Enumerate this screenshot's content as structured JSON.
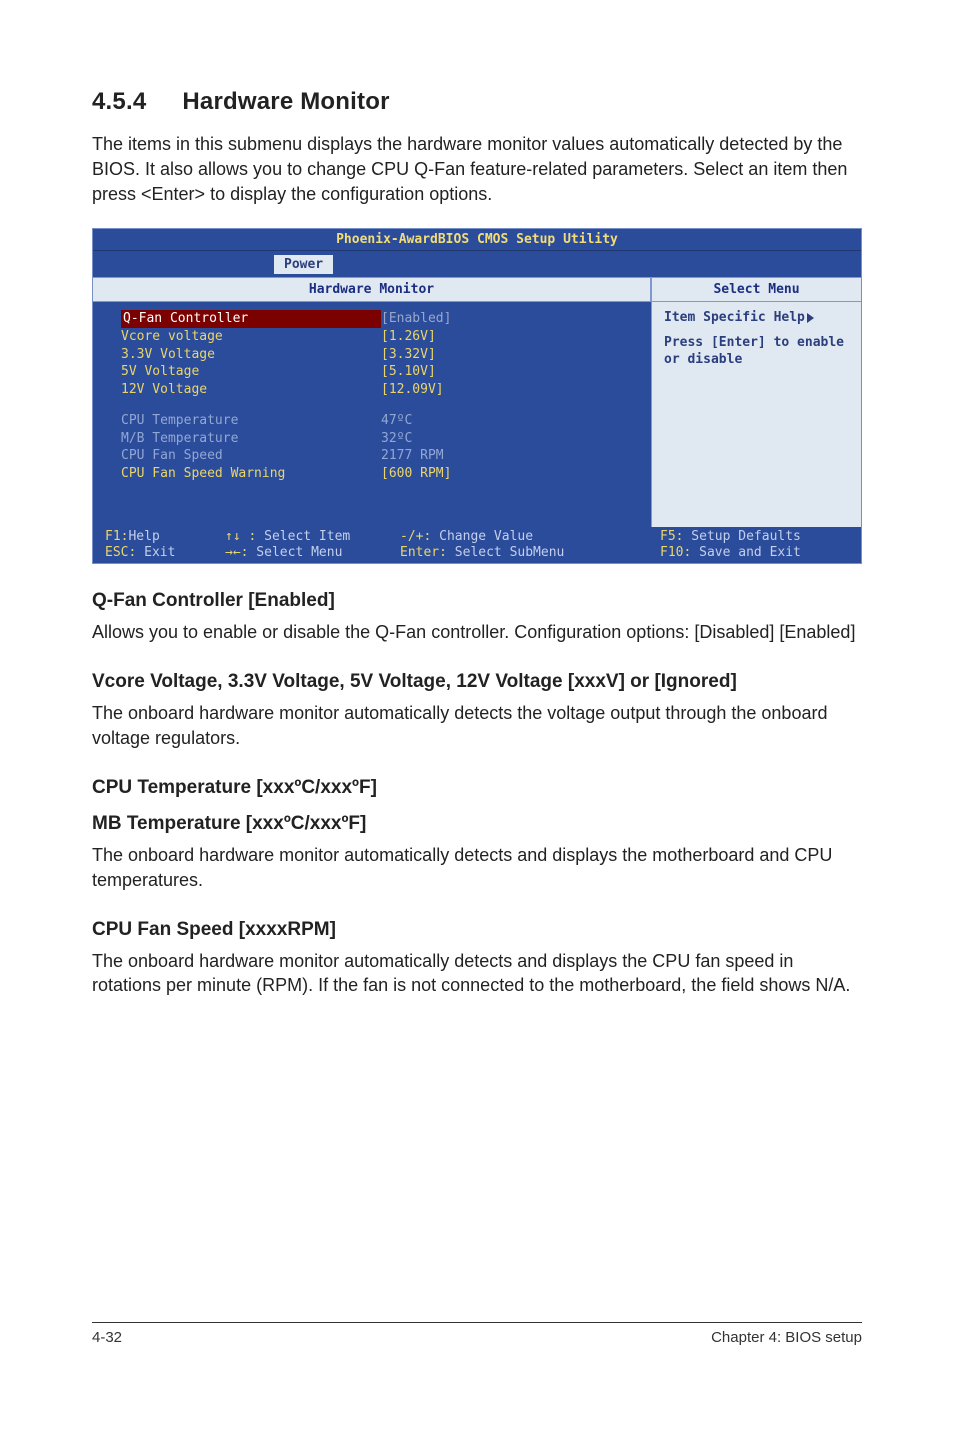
{
  "section": {
    "number": "4.5.4",
    "title": "Hardware Monitor"
  },
  "intro": "The items in this submenu displays the hardware monitor values automatically detected by the BIOS. It also allows you to change CPU Q-Fan feature-related parameters. Select an item then press <Enter> to display the configuration options.",
  "bios": {
    "title": "Phoenix-AwardBIOS CMOS Setup Utility",
    "tab": "Power",
    "hw_header": "Hardware Monitor",
    "select_header": "Select Menu",
    "rows": [
      {
        "label": "Q-Fan Controller",
        "value": "[Enabled]"
      },
      {
        "label": "Vcore voltage",
        "value": "[1.26V]"
      },
      {
        "label": "3.3V Voltage",
        "value": "[3.32V]"
      },
      {
        "label": "5V Voltage",
        "value": "[5.10V]"
      },
      {
        "label": "12V Voltage",
        "value": "[12.09V]"
      },
      {
        "label": "CPU Temperature",
        "value": "47ºC"
      },
      {
        "label": "M/B Temperature",
        "value": "32ºC"
      },
      {
        "label": "CPU Fan Speed",
        "value": "2177 RPM"
      },
      {
        "label": "CPU Fan Speed Warning",
        "value": "[600 RPM]"
      }
    ],
    "help": {
      "line1": "Item Specific Help",
      "body": "Press [Enter] to enable or disable"
    },
    "footer": {
      "f1_label": "F1:",
      "f1_text": "Help",
      "updown_label": "↑↓ :",
      "updown_text": " Select Item",
      "pm_label": "-/+:",
      "pm_text": " Change Value",
      "f5_label": "F5:",
      "f5_text": " Setup Defaults",
      "esc_label": "ESC:",
      "esc_text": " Exit",
      "lr_label": "→←:",
      "lr_text": " Select Menu",
      "enter_label": "Enter:",
      "enter_text": " Select SubMenu",
      "f10_label": "F10:",
      "f10_text": " Save and Exit"
    }
  },
  "blocks": {
    "qfan_h": "Q-Fan Controller [Enabled]",
    "qfan_p": "Allows you to enable or disable the Q-Fan controller. Configuration options: [Disabled] [Enabled]",
    "volt_h": "Vcore Voltage, 3.3V Voltage, 5V Voltage, 12V Voltage [xxxV] or [Ignored]",
    "volt_p": "The onboard hardware monitor automatically detects the voltage output through the onboard voltage regulators.",
    "cput_h": "CPU Temperature [xxxºC/xxxºF]",
    "mbt_h": "MB Temperature [xxxºC/xxxºF]",
    "temp_p": "The onboard hardware monitor automatically detects and displays the motherboard and CPU temperatures.",
    "fan_h": "CPU Fan Speed [xxxxRPM]",
    "fan_p": "The onboard hardware monitor automatically detects and displays the CPU fan speed in rotations per minute (RPM). If the fan is not connected to the motherboard, the field shows N/A."
  },
  "pagefooter": {
    "left": "4-32",
    "right": "Chapter 4: BIOS setup"
  }
}
